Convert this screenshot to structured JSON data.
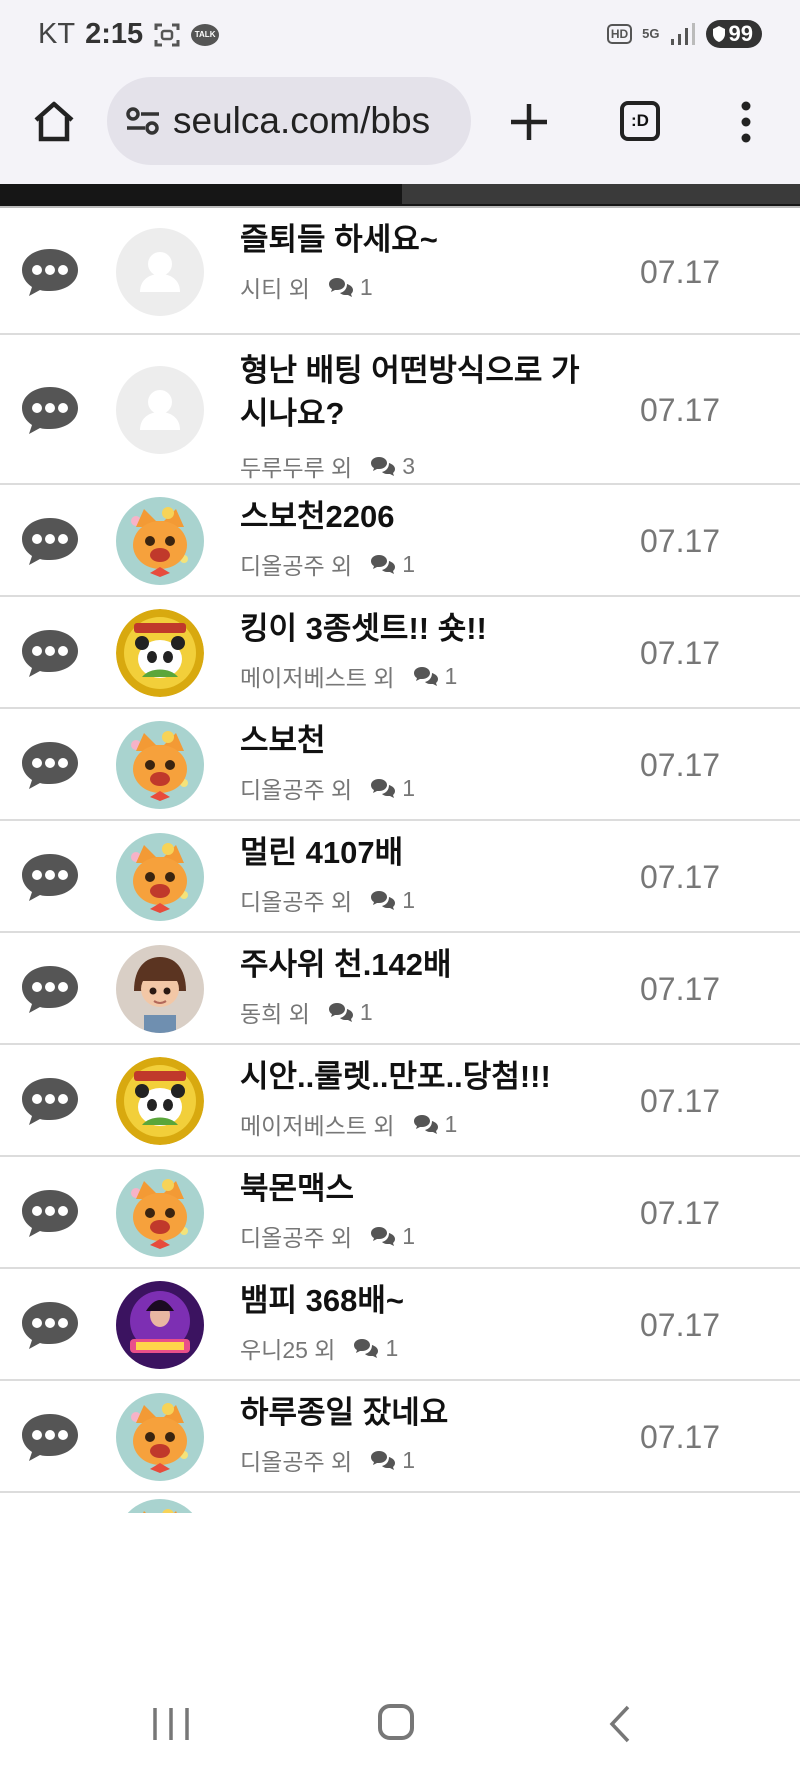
{
  "status_bar": {
    "carrier": "KT",
    "time": "2:15",
    "talk_label": "TALK",
    "hd_label": "HD",
    "network_label": "5G",
    "battery": "99"
  },
  "browser": {
    "url": "seulca.com/bbs",
    "tabs_label": ":D"
  },
  "posts": [
    {
      "title": "즐퇴들 하세요~",
      "author": "시티 외",
      "comments": "1",
      "date": "07.17",
      "avatar": "default"
    },
    {
      "title": "형난 배팅 어떤방식으로 가시나요?",
      "author": "두루두루 외",
      "comments": "3",
      "date": "07.17",
      "avatar": "default"
    },
    {
      "title": "스보천2206",
      "author": "디올공주 외",
      "comments": "1",
      "date": "07.17",
      "avatar": "cat"
    },
    {
      "title": "킹이 3종셋트!! 숏!!",
      "author": "메이저베스트 외",
      "comments": "1",
      "date": "07.17",
      "avatar": "panda"
    },
    {
      "title": "스보천",
      "author": "디올공주 외",
      "comments": "1",
      "date": "07.17",
      "avatar": "cat"
    },
    {
      "title": "멀린 4107배",
      "author": "디올공주 외",
      "comments": "1",
      "date": "07.17",
      "avatar": "cat"
    },
    {
      "title": "주사위 천.142배",
      "author": "동희 외",
      "comments": "1",
      "date": "07.17",
      "avatar": "doll"
    },
    {
      "title": "시안..룰렛..만포..당첨!!!",
      "author": "메이저베스트 외",
      "comments": "1",
      "date": "07.17",
      "avatar": "panda"
    },
    {
      "title": "북몬맥스",
      "author": "디올공주 외",
      "comments": "1",
      "date": "07.17",
      "avatar": "cat"
    },
    {
      "title": "뱀피 368배~",
      "author": "우니25 외",
      "comments": "1",
      "date": "07.17",
      "avatar": "slot"
    },
    {
      "title": "하루종일 잤네요",
      "author": "디올공주 외",
      "comments": "1",
      "date": "07.17",
      "avatar": "cat"
    }
  ],
  "colors": {
    "chrome_bg": "#f4f3f8",
    "url_bg": "#e4e2ea",
    "meta_gray": "#777777",
    "divider": "#dcdcdc",
    "icon_gray": "#555555"
  }
}
